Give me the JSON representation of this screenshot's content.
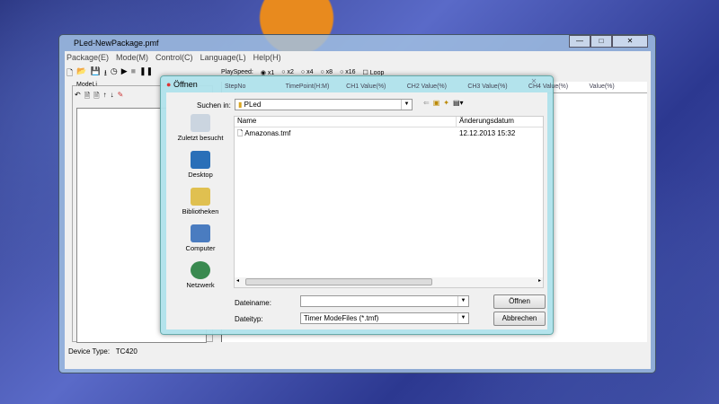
{
  "window": {
    "title": "PLed-NewPackage.pmf",
    "controls": [
      "—",
      "□",
      "✕"
    ]
  },
  "menu": [
    "Package(E)",
    "Mode(M)",
    "Control(C)",
    "Language(L)",
    "Help(H)"
  ],
  "toolbar": {
    "speed_label": "PlaySpeed:",
    "speeds": [
      "x1",
      "x2",
      "x4",
      "x8",
      "x16"
    ],
    "selected_speed": "x1",
    "loop_label": "Loop",
    "loop_checked": false
  },
  "mode_list": {
    "label": "ModeLi"
  },
  "grid": {
    "columns": [
      "StepNo",
      "TimePoint(H:M)",
      "CH1 Value(%)",
      "CH2 Value(%)",
      "CH3 Value(%)",
      "CH4 Value(%)",
      "Value(%)"
    ]
  },
  "device": {
    "label": "Device Type:",
    "value": "TC420"
  },
  "dialog": {
    "title": "Öffnen",
    "look_in_label": "Suchen in:",
    "look_in_value": "PLed",
    "places": [
      "Zuletzt besucht",
      "Desktop",
      "Bibliotheken",
      "Computer",
      "Netzwerk"
    ],
    "columns": [
      "Name",
      "Änderungsdatum"
    ],
    "files": [
      {
        "name": "Amazonas.tmf",
        "date": "12.12.2013 15:32"
      }
    ],
    "filename_label": "Dateiname:",
    "filename_value": "",
    "filetype_label": "Dateityp:",
    "filetype_value": "Timer ModeFiles (*.tmf)",
    "open_button": "Öffnen",
    "cancel_button": "Abbrechen"
  }
}
